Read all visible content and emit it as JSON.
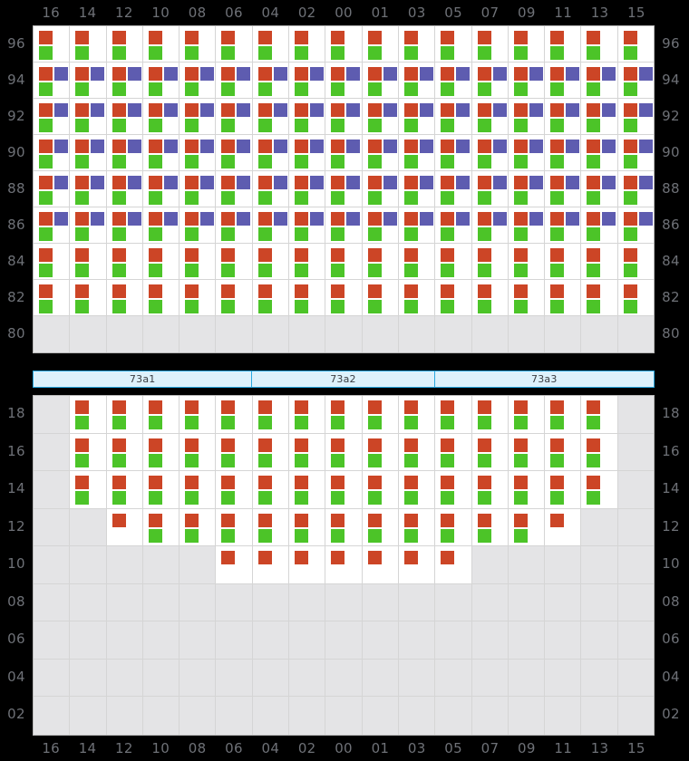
{
  "colors": {
    "red": "#cc4526",
    "green": "#4cc428",
    "purple": "#5e5cb0",
    "empty_cell": "#e4e4e6",
    "grid_line": "#d5d5d5",
    "background": "#000000",
    "label": "#6e7177",
    "segment_border": "#29a8e0",
    "segment_fill": "#ddf1fb"
  },
  "columns": {
    "labels": [
      "16",
      "14",
      "12",
      "10",
      "08",
      "06",
      "04",
      "02",
      "00",
      "01",
      "03",
      "05",
      "07",
      "09",
      "11",
      "13",
      "15"
    ]
  },
  "segment_bar": {
    "segments": [
      {
        "label": "73a1",
        "span": 6
      },
      {
        "label": "73a2",
        "span": 5
      },
      {
        "label": "73a3",
        "span": 6
      }
    ]
  },
  "upper_grid": {
    "row_labels": [
      "96",
      "94",
      "92",
      "90",
      "88",
      "86",
      "84",
      "82",
      "80"
    ],
    "rows": [
      {
        "label": "96",
        "cells": [
          "rg",
          "rg",
          "rg",
          "rg",
          "rg",
          "rg",
          "rg",
          "rg",
          "rg",
          "rg",
          "rg",
          "rg",
          "rg",
          "rg",
          "rg",
          "rg",
          "rg"
        ]
      },
      {
        "label": "94",
        "cells": [
          "rpg",
          "rpg",
          "rpg",
          "rpg",
          "rpg",
          "rpg",
          "rpg",
          "rpg",
          "rpg",
          "rpg",
          "rpg",
          "rpg",
          "rpg",
          "rpg",
          "rpg",
          "rpg",
          "rpg"
        ]
      },
      {
        "label": "92",
        "cells": [
          "rpg",
          "rpg",
          "rpg",
          "rpg",
          "rpg",
          "rpg",
          "rpg",
          "rpg",
          "rpg",
          "rpg",
          "rpg",
          "rpg",
          "rpg",
          "rpg",
          "rpg",
          "rpg",
          "rpg"
        ]
      },
      {
        "label": "90",
        "cells": [
          "rpg",
          "rpg",
          "rpg",
          "rpg",
          "rpg",
          "rpg",
          "rpg",
          "rpg",
          "rpg",
          "rpg",
          "rpg",
          "rpg",
          "rpg",
          "rpg",
          "rpg",
          "rpg",
          "rpg"
        ]
      },
      {
        "label": "88",
        "cells": [
          "rpg",
          "rpg",
          "rpg",
          "rpg",
          "rpg",
          "rpg",
          "rpg",
          "rpg",
          "rpg",
          "rpg",
          "rpg",
          "rpg",
          "rpg",
          "rpg",
          "rpg",
          "rpg",
          "rpg"
        ]
      },
      {
        "label": "86",
        "cells": [
          "rpg",
          "rpg",
          "rpg",
          "rpg",
          "rpg",
          "rpg",
          "rpg",
          "rpg",
          "rpg",
          "rpg",
          "rpg",
          "rpg",
          "rpg",
          "rpg",
          "rpg",
          "rpg",
          "rpg"
        ]
      },
      {
        "label": "84",
        "cells": [
          "rg",
          "rg",
          "rg",
          "rg",
          "rg",
          "rg",
          "rg",
          "rg",
          "rg",
          "rg",
          "rg",
          "rg",
          "rg",
          "rg",
          "rg",
          "rg",
          "rg"
        ]
      },
      {
        "label": "82",
        "cells": [
          "rg",
          "rg",
          "rg",
          "rg",
          "rg",
          "rg",
          "rg",
          "rg",
          "rg",
          "rg",
          "rg",
          "rg",
          "rg",
          "rg",
          "rg",
          "rg",
          "rg"
        ]
      },
      {
        "label": "80",
        "cells": [
          "-",
          "-",
          "-",
          "-",
          "-",
          "-",
          "-",
          "-",
          "-",
          "-",
          "-",
          "-",
          "-",
          "-",
          "-",
          "-",
          "-"
        ]
      }
    ]
  },
  "lower_grid": {
    "row_labels": [
      "18",
      "16",
      "14",
      "12",
      "10",
      "08",
      "06",
      "04",
      "02"
    ],
    "rows": [
      {
        "label": "18",
        "cells": [
          "-",
          "rg",
          "rg",
          "rg",
          "rg",
          "rg",
          "rg",
          "rg",
          "rg",
          "rg",
          "rg",
          "rg",
          "rg",
          "rg",
          "rg",
          "rg",
          "-"
        ]
      },
      {
        "label": "16",
        "cells": [
          "-",
          "rg",
          "rg",
          "rg",
          "rg",
          "rg",
          "rg",
          "rg",
          "rg",
          "rg",
          "rg",
          "rg",
          "rg",
          "rg",
          "rg",
          "rg",
          "-"
        ]
      },
      {
        "label": "14",
        "cells": [
          "-",
          "rg",
          "rg",
          "rg",
          "rg",
          "rg",
          "rg",
          "rg",
          "rg",
          "rg",
          "rg",
          "rg",
          "rg",
          "rg",
          "rg",
          "rg",
          "-"
        ]
      },
      {
        "label": "12",
        "cells": [
          "-",
          "-",
          "r",
          "rg",
          "rg",
          "rg",
          "rg",
          "rg",
          "rg",
          "rg",
          "rg",
          "rg",
          "rg",
          "rg",
          "r",
          "-",
          "-"
        ]
      },
      {
        "label": "10",
        "cells": [
          "-",
          "-",
          "-",
          "-",
          "-",
          "r",
          "r",
          "r",
          "r",
          "r",
          "r",
          "r",
          "-",
          "-",
          "-",
          "-",
          "-"
        ]
      },
      {
        "label": "08",
        "cells": [
          "-",
          "-",
          "-",
          "-",
          "-",
          "-",
          "-",
          "-",
          "-",
          "-",
          "-",
          "-",
          "-",
          "-",
          "-",
          "-",
          "-"
        ]
      },
      {
        "label": "06",
        "cells": [
          "-",
          "-",
          "-",
          "-",
          "-",
          "-",
          "-",
          "-",
          "-",
          "-",
          "-",
          "-",
          "-",
          "-",
          "-",
          "-",
          "-"
        ]
      },
      {
        "label": "04",
        "cells": [
          "-",
          "-",
          "-",
          "-",
          "-",
          "-",
          "-",
          "-",
          "-",
          "-",
          "-",
          "-",
          "-",
          "-",
          "-",
          "-",
          "-"
        ]
      },
      {
        "label": "02",
        "cells": [
          "-",
          "-",
          "-",
          "-",
          "-",
          "-",
          "-",
          "-",
          "-",
          "-",
          "-",
          "-",
          "-",
          "-",
          "-",
          "-",
          "-"
        ]
      }
    ]
  },
  "chart_data": {
    "type": "heatmap",
    "title": "",
    "xlabel": "",
    "ylabel": "",
    "x_categories": [
      "16",
      "14",
      "12",
      "10",
      "08",
      "06",
      "04",
      "02",
      "00",
      "01",
      "03",
      "05",
      "07",
      "09",
      "11",
      "13",
      "15"
    ],
    "panels": [
      {
        "name": "upper",
        "y_categories": [
          "96",
          "94",
          "92",
          "90",
          "88",
          "86",
          "84",
          "82",
          "80"
        ],
        "cell_codes": [
          [
            "rg",
            "rg",
            "rg",
            "rg",
            "rg",
            "rg",
            "rg",
            "rg",
            "rg",
            "rg",
            "rg",
            "rg",
            "rg",
            "rg",
            "rg",
            "rg",
            "rg"
          ],
          [
            "rpg",
            "rpg",
            "rpg",
            "rpg",
            "rpg",
            "rpg",
            "rpg",
            "rpg",
            "rpg",
            "rpg",
            "rpg",
            "rpg",
            "rpg",
            "rpg",
            "rpg",
            "rpg",
            "rpg"
          ],
          [
            "rpg",
            "rpg",
            "rpg",
            "rpg",
            "rpg",
            "rpg",
            "rpg",
            "rpg",
            "rpg",
            "rpg",
            "rpg",
            "rpg",
            "rpg",
            "rpg",
            "rpg",
            "rpg",
            "rpg"
          ],
          [
            "rpg",
            "rpg",
            "rpg",
            "rpg",
            "rpg",
            "rpg",
            "rpg",
            "rpg",
            "rpg",
            "rpg",
            "rpg",
            "rpg",
            "rpg",
            "rpg",
            "rpg",
            "rpg",
            "rpg"
          ],
          [
            "rpg",
            "rpg",
            "rpg",
            "rpg",
            "rpg",
            "rpg",
            "rpg",
            "rpg",
            "rpg",
            "rpg",
            "rpg",
            "rpg",
            "rpg",
            "rpg",
            "rpg",
            "rpg",
            "rpg"
          ],
          [
            "rpg",
            "rpg",
            "rpg",
            "rpg",
            "rpg",
            "rpg",
            "rpg",
            "rpg",
            "rpg",
            "rpg",
            "rpg",
            "rpg",
            "rpg",
            "rpg",
            "rpg",
            "rpg",
            "rpg"
          ],
          [
            "rg",
            "rg",
            "rg",
            "rg",
            "rg",
            "rg",
            "rg",
            "rg",
            "rg",
            "rg",
            "rg",
            "rg",
            "rg",
            "rg",
            "rg",
            "rg",
            "rg"
          ],
          [
            "rg",
            "rg",
            "rg",
            "rg",
            "rg",
            "rg",
            "rg",
            "rg",
            "rg",
            "rg",
            "rg",
            "rg",
            "rg",
            "rg",
            "rg",
            "rg",
            "rg"
          ],
          [
            "-",
            "-",
            "-",
            "-",
            "-",
            "-",
            "-",
            "-",
            "-",
            "-",
            "-",
            "-",
            "-",
            "-",
            "-",
            "-",
            "-"
          ]
        ]
      },
      {
        "name": "lower",
        "y_categories": [
          "18",
          "16",
          "14",
          "12",
          "10",
          "08",
          "06",
          "04",
          "02"
        ],
        "cell_codes": [
          [
            "-",
            "rg",
            "rg",
            "rg",
            "rg",
            "rg",
            "rg",
            "rg",
            "rg",
            "rg",
            "rg",
            "rg",
            "rg",
            "rg",
            "rg",
            "rg",
            "-"
          ],
          [
            "-",
            "rg",
            "rg",
            "rg",
            "rg",
            "rg",
            "rg",
            "rg",
            "rg",
            "rg",
            "rg",
            "rg",
            "rg",
            "rg",
            "rg",
            "rg",
            "-"
          ],
          [
            "-",
            "rg",
            "rg",
            "rg",
            "rg",
            "rg",
            "rg",
            "rg",
            "rg",
            "rg",
            "rg",
            "rg",
            "rg",
            "rg",
            "rg",
            "rg",
            "-"
          ],
          [
            "-",
            "-",
            "r",
            "rg",
            "rg",
            "rg",
            "rg",
            "rg",
            "rg",
            "rg",
            "rg",
            "rg",
            "rg",
            "rg",
            "r",
            "-",
            "-"
          ],
          [
            "-",
            "-",
            "-",
            "-",
            "-",
            "r",
            "r",
            "r",
            "r",
            "r",
            "r",
            "r",
            "-",
            "-",
            "-",
            "-",
            "-"
          ],
          [
            "-",
            "-",
            "-",
            "-",
            "-",
            "-",
            "-",
            "-",
            "-",
            "-",
            "-",
            "-",
            "-",
            "-",
            "-",
            "-",
            "-"
          ],
          [
            "-",
            "-",
            "-",
            "-",
            "-",
            "-",
            "-",
            "-",
            "-",
            "-",
            "-",
            "-",
            "-",
            "-",
            "-",
            "-",
            "-"
          ],
          [
            "-",
            "-",
            "-",
            "-",
            "-",
            "-",
            "-",
            "-",
            "-",
            "-",
            "-",
            "-",
            "-",
            "-",
            "-",
            "-",
            "-"
          ],
          [
            "-",
            "-",
            "-",
            "-",
            "-",
            "-",
            "-",
            "-",
            "-",
            "-",
            "-",
            "-",
            "-",
            "-",
            "-",
            "-",
            "-"
          ]
        ]
      }
    ],
    "legend": [
      {
        "code": "r",
        "name": "red-mark",
        "color": "#cc4526"
      },
      {
        "code": "g",
        "name": "green-mark",
        "color": "#4cc428"
      },
      {
        "code": "p",
        "name": "purple-mark",
        "color": "#5e5cb0"
      }
    ]
  }
}
